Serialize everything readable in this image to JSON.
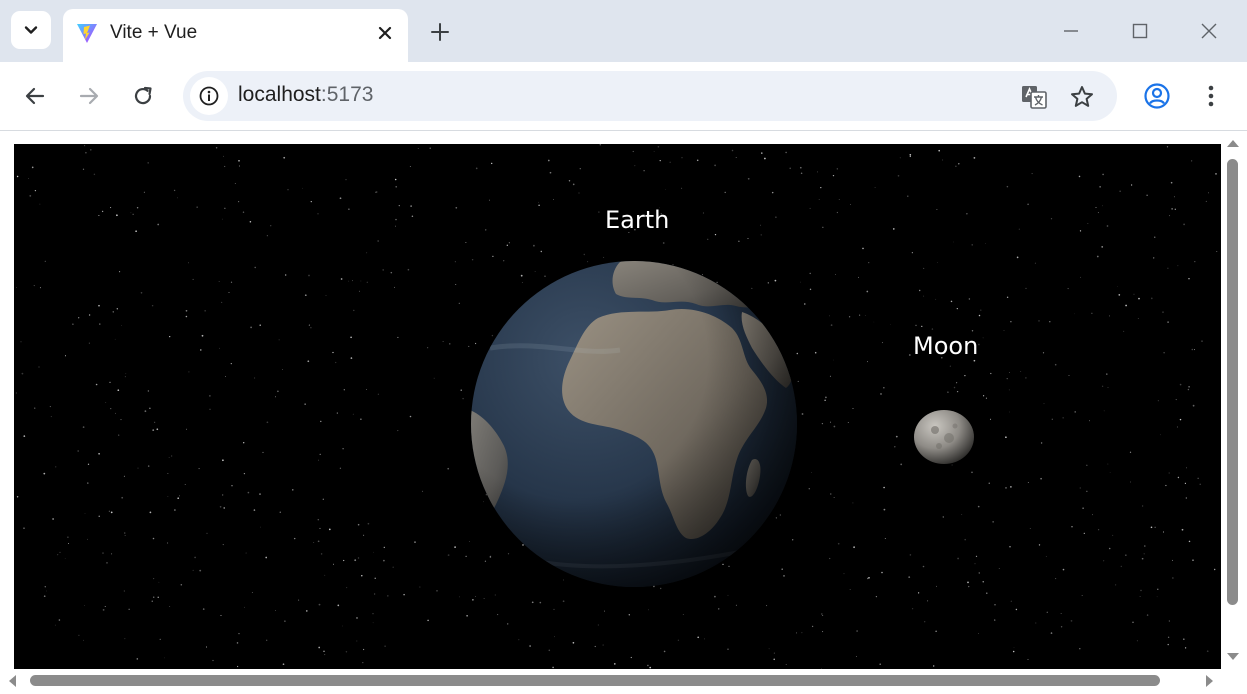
{
  "browser": {
    "tab": {
      "title": "Vite + Vue",
      "favicon": "vite-logo-icon"
    },
    "address": {
      "host": "localhost",
      "port": ":5173"
    },
    "colors": {
      "tabstrip": "#dfe5ee",
      "omnibox": "#edf1f8",
      "icon": "#3c4043",
      "profile": "#1a73e8"
    }
  },
  "scene": {
    "background": "#000000",
    "labels": {
      "earth": "Earth",
      "moon": "Moon"
    }
  }
}
